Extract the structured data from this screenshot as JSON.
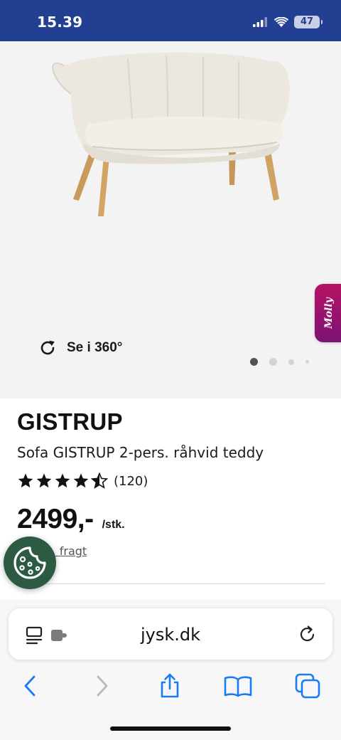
{
  "status_bar": {
    "time": "15.39",
    "battery": "47",
    "icons": [
      "signal-icon",
      "wifi-icon",
      "battery-icon"
    ]
  },
  "gallery": {
    "image": "sofa-product-image",
    "view_360_label": "Se i 360°",
    "active_slide": 1,
    "slide_count": 4
  },
  "chat_widget": {
    "label": "Molly"
  },
  "product": {
    "title": "GISTRUP",
    "subtitle": "Sofa GISTRUP 2-pers. råhvid teddy",
    "rating": 4.5,
    "rating_count": "(120)",
    "price": "2499,-",
    "unit": "/stk.",
    "freight_text": "evt. fragt"
  },
  "cookie_button": {
    "icon": "cookie-icon"
  },
  "browser": {
    "url": "jysk.dk",
    "icons": [
      "reader-icon",
      "extension-icon",
      "reload-icon",
      "back-icon",
      "forward-icon",
      "share-icon",
      "bookmarks-icon",
      "tabs-icon"
    ]
  },
  "colors": {
    "status_bar": "#233f91",
    "cookie_button": "#2c5a43",
    "molly_gradient_top": "#b61264",
    "molly_gradient_bottom": "#7b1373",
    "browser_accent": "#1a7cf2"
  }
}
